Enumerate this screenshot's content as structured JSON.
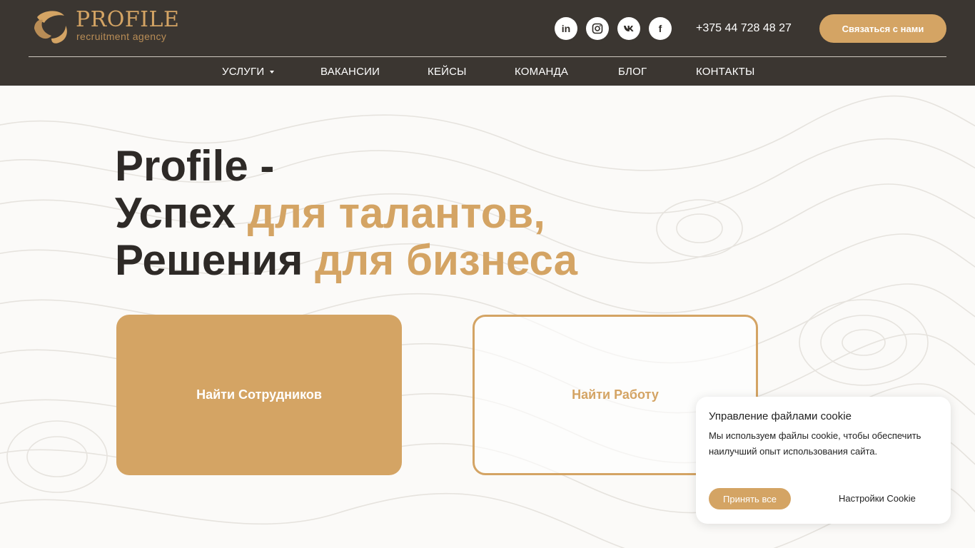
{
  "colors": {
    "header_bg": "#3b3631",
    "accent": "#d4a464",
    "text_dark": "#2e2a27",
    "white": "#ffffff"
  },
  "logo": {
    "name": "PROFILE",
    "tagline": "recruitment agency"
  },
  "socials": [
    {
      "name": "linkedin-icon",
      "glyph": "in"
    },
    {
      "name": "instagram-icon",
      "glyph": ""
    },
    {
      "name": "vk-icon",
      "glyph": ""
    },
    {
      "name": "facebook-icon",
      "glyph": "f"
    }
  ],
  "header": {
    "phone": "+375 44 728 48 27",
    "contact_label": "Связаться с нами"
  },
  "nav": {
    "items": [
      {
        "label": "УСЛУГИ"
      },
      {
        "label": "ВАКАНСИИ"
      },
      {
        "label": "КЕЙСЫ"
      },
      {
        "label": "КОМАНДА"
      },
      {
        "label": "БЛОГ"
      },
      {
        "label": "КОНТАКТЫ"
      }
    ]
  },
  "hero": {
    "line1": "Profile -",
    "line2_main": "Успех ",
    "line2_accent": "для талантов,",
    "line3_main": "Решения ",
    "line3_accent": "для бизнеса",
    "btn_employees": "Найти Сотрудников",
    "btn_job": "Найти Работу"
  },
  "cookie": {
    "title": "Управление файлами cookie",
    "text": "Мы используем файлы cookie, чтобы обеспечить наилучший опыт использования сайта.",
    "accept": "Принять все",
    "settings": "Настройки Cookie"
  }
}
